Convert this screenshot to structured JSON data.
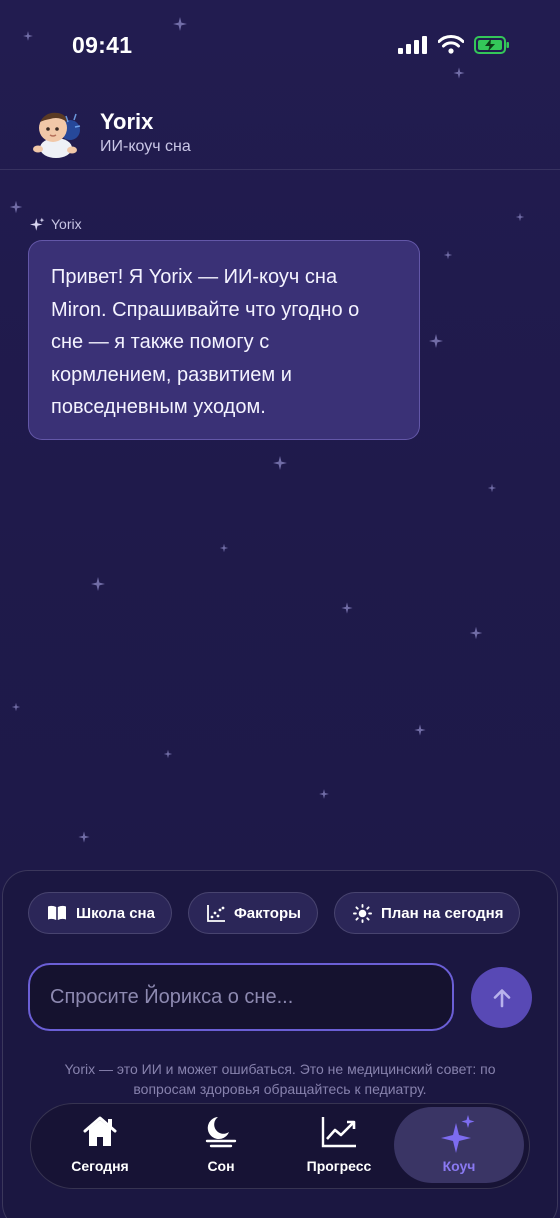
{
  "status_bar": {
    "time": "09:41"
  },
  "header": {
    "title": "Yorix",
    "subtitle": "ИИ-коуч сна"
  },
  "messages": [
    {
      "sender": "Yorix",
      "lines": [
        "Привет! Я Yorix — ИИ-коуч сна",
        "Miron. Спрашивайте что угодно о",
        "сне — я также помогу с",
        "кормлением, развитием и",
        "повседневным уходом."
      ]
    }
  ],
  "chips": [
    {
      "label": "Школа сна",
      "icon": "book-icon"
    },
    {
      "label": "Факторы",
      "icon": "scatter-chart-icon"
    },
    {
      "label": "План на сегодня",
      "icon": "sun-icon"
    }
  ],
  "composer": {
    "placeholder": "Спросите Йорикса о сне..."
  },
  "disclaimer": {
    "line1": "Yorix — это ИИ и может ошибаться. Это не медицинский совет: по",
    "line2": "вопросам здоровья обращайтесь к педиатру."
  },
  "tabs": [
    {
      "label": "Сегодня",
      "icon": "home-icon"
    },
    {
      "label": "Сон",
      "icon": "moon-icon"
    },
    {
      "label": "Прогресс",
      "icon": "trend-chart-icon"
    },
    {
      "label": "Коуч",
      "icon": "sparkle-icon",
      "active": true
    }
  ],
  "colors": {
    "background": "#1f1a4a",
    "bubble": "#3a3176",
    "accent": "#8a79f2",
    "send_button": "#5849b5",
    "battery": "#34c759"
  }
}
